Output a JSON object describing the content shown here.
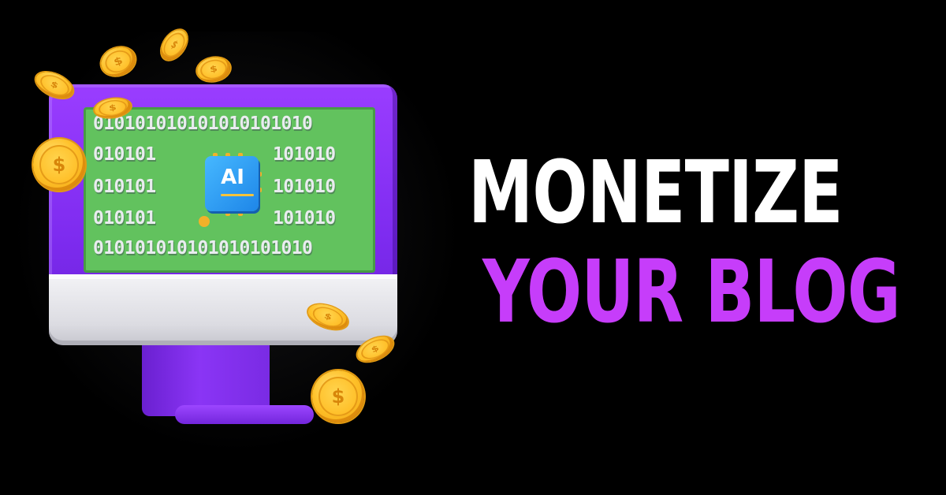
{
  "headline": {
    "line1": "MONETIZE",
    "line2": "YOUR BLOG"
  },
  "screen": {
    "binary_rows": [
      [
        "010101010101010101010"
      ],
      [
        "010101",
        "101010"
      ],
      [
        "010101",
        "101010"
      ],
      [
        "010101",
        "101010"
      ],
      [
        "010101010101010101010"
      ]
    ],
    "chip_label": "AI"
  },
  "coin_symbol": "$",
  "colors": {
    "background": "#000000",
    "headline_white": "#ffffff",
    "headline_purple": "#c63dfa",
    "monitor_purple": "#8a35f5",
    "screen_green": "#62c25e",
    "coin_gold": "#ffc22a",
    "chip_blue": "#2b9af0"
  },
  "icons": {
    "coin": "dollar-coin-icon",
    "chip": "ai-chip-icon"
  }
}
